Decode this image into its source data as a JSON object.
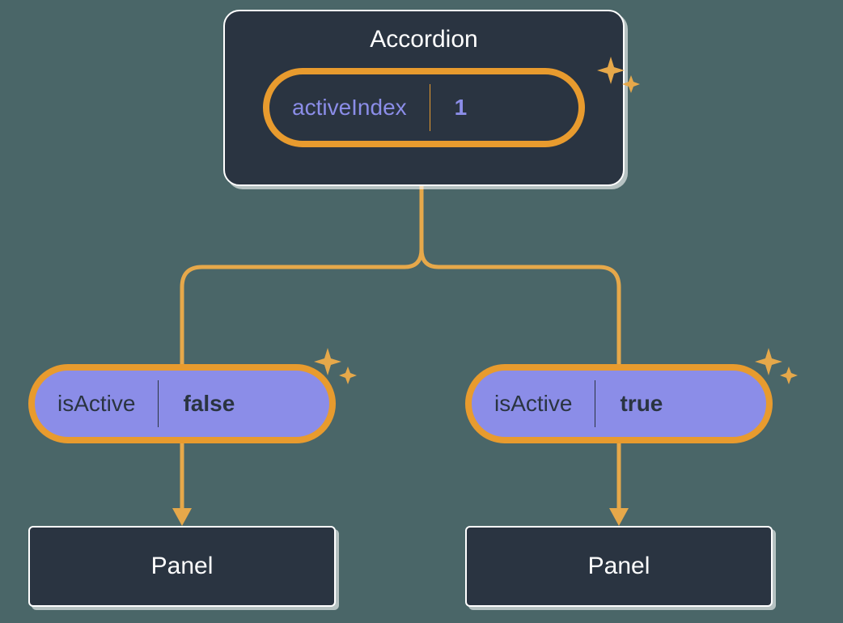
{
  "parent": {
    "title": "Accordion",
    "state": {
      "label": "activeIndex",
      "value": "1"
    }
  },
  "children": [
    {
      "prop": {
        "label": "isActive",
        "value": "false"
      },
      "component": "Panel"
    },
    {
      "prop": {
        "label": "isActive",
        "value": "true"
      },
      "component": "Panel"
    }
  ],
  "colors": {
    "bg": "#4a6668",
    "card": "#2a3441",
    "accent": "#e89b2e",
    "purple": "#8b8de8",
    "sparkle": "#e6a84a"
  }
}
